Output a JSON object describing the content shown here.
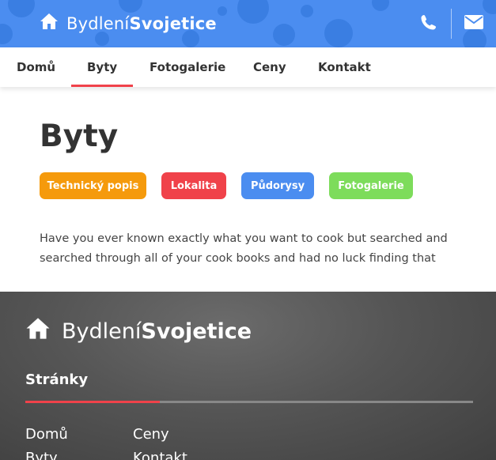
{
  "header": {
    "brand_light": "Bydlení",
    "brand_bold": "Svojetice",
    "icons": [
      "home-icon",
      "phone-icon",
      "envelope-icon"
    ]
  },
  "nav": {
    "items": [
      {
        "label": "Domů"
      },
      {
        "label": "Byty"
      },
      {
        "label": "Fotogalerie"
      },
      {
        "label": "Ceny"
      },
      {
        "label": "Kontakt"
      }
    ],
    "active": "Byty"
  },
  "main": {
    "title": "Byty",
    "tags": [
      {
        "label": "Technický popis",
        "color": "#f59a0c"
      },
      {
        "label": "Lokalita",
        "color": "#f0424a"
      },
      {
        "label": "Půdorysy",
        "color": "#4b8df0"
      },
      {
        "label": "Fotogalerie",
        "color": "#7ddc5b"
      }
    ],
    "lead": "Have you ever known exactly what you want to cook but searched and searched through all of your cook books and had no luck finding that"
  },
  "footer": {
    "brand_light": "Bydlení",
    "brand_bold": "Svojetice",
    "section_title": "Stránky",
    "links": [
      "Domů",
      "Ceny",
      "Byty",
      "Kontakt"
    ]
  },
  "colors": {
    "header_blue": "#4b8df0",
    "accent_red": "#f0424a",
    "text_dark": "#333333"
  }
}
